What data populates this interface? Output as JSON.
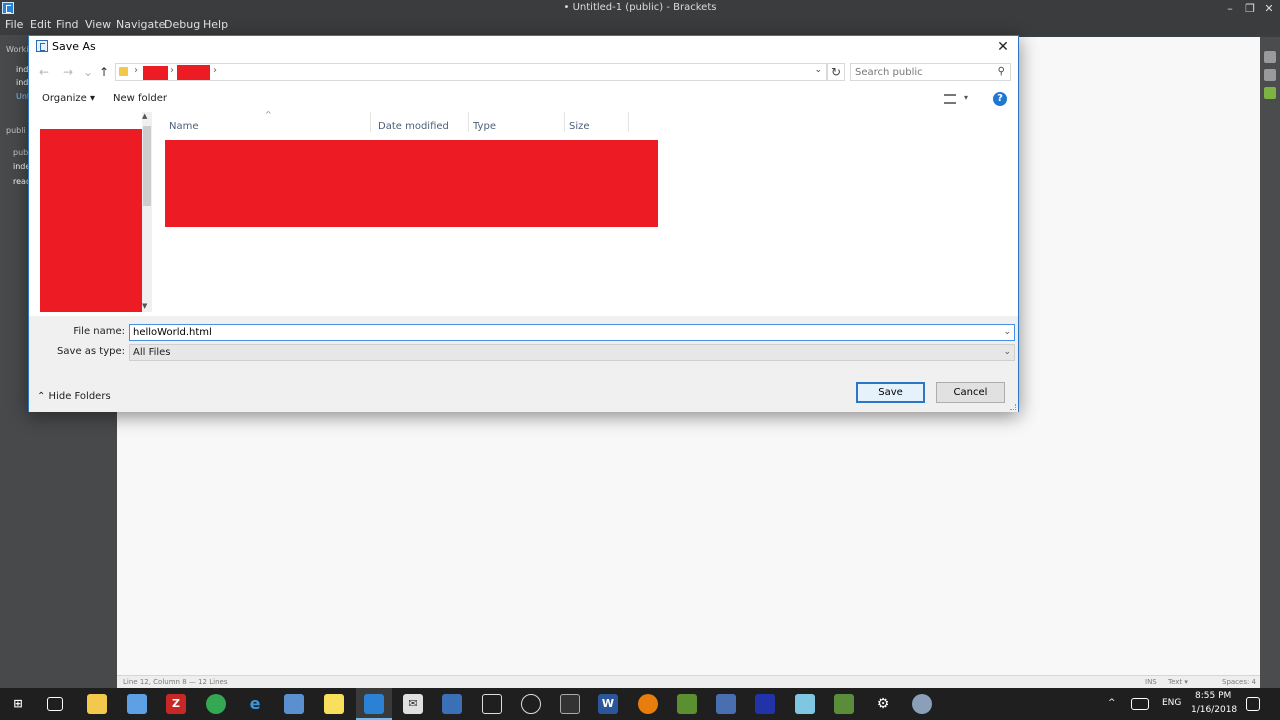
{
  "window": {
    "title": "• Untitled-1 (public) - Brackets",
    "minimize": "–",
    "maximize": "❐",
    "close": "✕"
  },
  "menu": [
    "File",
    "Edit",
    "Find",
    "View",
    "Navigate",
    "Debug",
    "Help"
  ],
  "sidebar": {
    "working_files_label": "Worki",
    "working_files": [
      "ind",
      "ind",
      "Unt"
    ],
    "project_label": "publi",
    "project_items": [
      "pub",
      "inde",
      "read"
    ]
  },
  "dialog": {
    "title": "Save As",
    "close": "✕",
    "nav": {
      "back": "←",
      "forward": "→",
      "recent": "⌄",
      "up": "↑",
      "refresh": "↻",
      "breadcrumb_sep": "›",
      "dropdown": "⌄"
    },
    "search": {
      "placeholder": "Search public",
      "icon": "⚲"
    },
    "toolbar": {
      "organize": "Organize ▾",
      "new_folder": "New folder",
      "help": "?",
      "view_dropdown": "▾"
    },
    "columns": [
      "Name",
      "Date modified",
      "Type",
      "Size"
    ],
    "sort_indicator": "^",
    "file_name_label": "File name:",
    "file_name_value": "helloWorld.html",
    "save_type_label": "Save as type:",
    "save_type_value": "All Files",
    "hide_folders": "⌃  Hide Folders",
    "save_button": "Save",
    "cancel_button": "Cancel",
    "field_dropdown": "⌄"
  },
  "statusbar": {
    "cursor": "Line 12, Column 8 — 12 Lines",
    "ins": "INS",
    "mode": "Text ▾",
    "spaces": "Spaces: 4"
  },
  "taskbar": {
    "icons": [
      "windows-start",
      "task-view",
      "file-explorer",
      "3d-app",
      "filezilla",
      "chrome",
      "edge",
      "network-app",
      "sticky-notes",
      "brackets",
      "mail",
      "virtualbox",
      "unity",
      "steam",
      "terminal",
      "word",
      "blender",
      "git",
      "network-monitor",
      "game-app",
      "notes-app",
      "minecraft",
      "settings",
      "tool-app"
    ],
    "tray_lang": "ENG",
    "time": "8:55 PM",
    "date": "1/16/2018",
    "tray_chevron": "^"
  },
  "colors": {
    "accent": "#2b77c5",
    "redaction": "#ed1c24",
    "taskbar": "#1f1f1f",
    "editor_chrome": "#3a3c3e"
  }
}
